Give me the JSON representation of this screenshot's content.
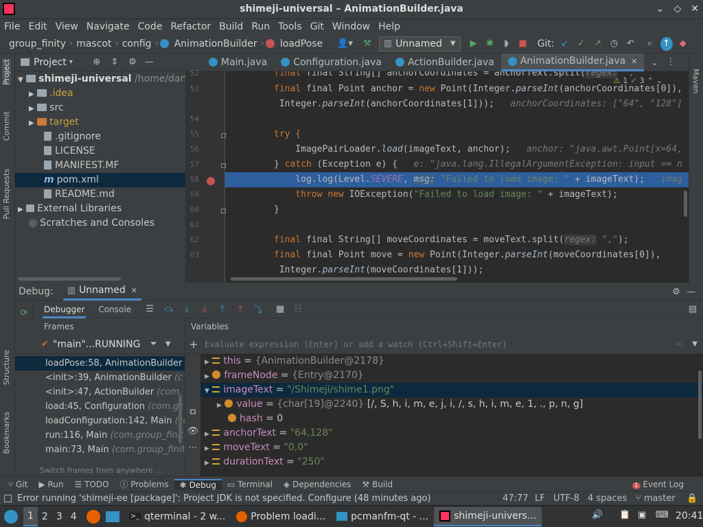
{
  "window": {
    "title": "shimeji-universal – AnimationBuilder.java"
  },
  "menu": [
    "File",
    "Edit",
    "View",
    "Navigate",
    "Code",
    "Refactor",
    "Build",
    "Run",
    "Tools",
    "Git",
    "Window",
    "Help"
  ],
  "breadcrumb": [
    "group_finity",
    "mascot",
    "config",
    "AnimationBuilder",
    "loadPose"
  ],
  "toolbar": {
    "run_config": "Unnamed",
    "git_label": "Git:"
  },
  "project": {
    "title": "Project",
    "root": "shimeji-universal",
    "root_path": "/home/dartz",
    "items": [
      ".idea",
      "src",
      "target",
      ".gitignore",
      "LICENSE",
      "MANIFEST.MF",
      "pom.xml",
      "README.md",
      "External Libraries",
      "Scratches and Consoles"
    ]
  },
  "side_left": [
    "Project",
    "Commit",
    "Pull Requests",
    "Structure",
    "Bookmarks"
  ],
  "side_right": [
    "Maven"
  ],
  "tabs": [
    "Main.java",
    "Configuration.java",
    "ActionBuilder.java",
    "AnimationBuilder.java"
  ],
  "inspections": {
    "warnings": "1",
    "ok": "3"
  },
  "code": {
    "line_numbers": [
      "52",
      "53",
      "",
      "54",
      "55",
      "56",
      "57",
      "58",
      "59",
      "60",
      "61",
      "62",
      "63",
      ""
    ],
    "l52": "final String[] anchorCoordinates = anchorText.split(",
    "l52_hint": "regex:",
    "l52_rest": "\",\"",
    "l53_a": "final Point anchor = ",
    "l53_b": "new",
    "l53_c": " Point(Integer.",
    "l53_d": "parseInt",
    "l53_e": "(anchorCoordinates[0]),",
    "l53c_a": " Integer.",
    "l53c_b": "parseInt",
    "l53c_c": "(anchorCoordinates[1]));",
    "l53c_hint": "anchorCoordinates: [\"64\", \"128\"]",
    "l55": "try {",
    "l56_a": "    ImagePairLoader.",
    "l56_b": "load",
    "l56_c": "(imageText, anchor);",
    "l56_hint": "anchor: \"java.awt.Point[x=64,",
    "l57_a": "} ",
    "l57_b": "catch",
    "l57_c": " (Exception e) {",
    "l57_hint": "e: \"java.lang.IllegalArgumentException: input == n",
    "l58_a": "    log.log(Level.",
    "l58_b": "SEVERE",
    "l58_c": ", ",
    "l58_hint": "msg:",
    "l58_d": "\"Failed to load image: \"",
    "l58_e": " + imageText);",
    "l58_hint2": "imag",
    "l59_a": "    throw new ",
    "l59_b": "IOException(",
    "l59_c": "\"Failed to load image: \"",
    "l59_d": " + imageText);",
    "l60": "}",
    "l62_a": "final String[] moveCoordinates = moveText.split(",
    "l62_hint": "regex:",
    "l62_b": "\",\"",
    "l62_c": ");",
    "l63_a": "final Point move = ",
    "l63_b": "new",
    "l63_c": " Point(Integer.",
    "l63_d": "parseInt",
    "l63_e": "(moveCoordinates[0]),",
    "l63c_a": " Integer.",
    "l63c_b": "parseInt",
    "l63c_c": "(moveCoordinates[1]));"
  },
  "debug": {
    "label": "Debug:",
    "session": "Unnamed",
    "tab_debugger": "Debugger",
    "tab_console": "Console",
    "frames_title": "Frames",
    "variables_title": "Variables",
    "thread": "\"main\"...RUNNING",
    "eval_placeholder": "Evaluate expression (Enter) or add a watch (Ctrl+Shift+Enter)",
    "switch_hint": "Switch frames from anywhere ..."
  },
  "frames": [
    {
      "m": "loadPose:58, AnimationBuilder",
      "p": ""
    },
    {
      "m": "<init>:39, AnimationBuilder",
      "p": "(c"
    },
    {
      "m": "<init>:47, ActionBuilder",
      "p": "(com."
    },
    {
      "m": "load:45, Configuration",
      "p": "(com.gr"
    },
    {
      "m": "loadConfiguration:142, Main",
      "p": "(co"
    },
    {
      "m": "run:116, Main",
      "p": "(com.group_finit"
    },
    {
      "m": "main:73, Main",
      "p": "(com.group_finit"
    }
  ],
  "variables": [
    {
      "n": "this",
      "v": "{AnimationBuilder@2178}",
      "k": "obj"
    },
    {
      "n": "frameNode",
      "v": "{Entry@2170}",
      "k": "obj"
    },
    {
      "n": "imageText",
      "v": "\"/Shimeji/shime1.png\"",
      "k": "str"
    },
    {
      "n": "value",
      "v": "{char[19]@2240}",
      "x": "[/, S, h, i, m, e, j, i, /, s, h, i, m, e, 1, ., p, n, g]",
      "k": "obj"
    },
    {
      "n": "hash",
      "v": "0",
      "k": "num"
    },
    {
      "n": "anchorText",
      "v": "\"64,128\"",
      "k": "str"
    },
    {
      "n": "moveText",
      "v": "\"0,0\"",
      "k": "str"
    },
    {
      "n": "durationText",
      "v": "\"250\"",
      "k": "str"
    }
  ],
  "bottom_tabs": [
    "Git",
    "Run",
    "TODO",
    "Problems",
    "Debug",
    "Terminal",
    "Dependencies",
    "Build"
  ],
  "event_log": "Event Log",
  "status": {
    "message": "Error running 'shimeji-ee [package]': Project JDK is not specified. Configure (48 minutes ago)",
    "position": "47:77",
    "line_sep": "LF",
    "encoding": "UTF-8",
    "indent": "4 spaces",
    "branch": "master"
  },
  "taskbar": {
    "workspaces": [
      "1",
      "2",
      "3",
      "4"
    ],
    "tasks": [
      "qterminal - 2 w...",
      "Problem loadi...",
      "pcmanfm-qt - ...",
      "shimeji-univers..."
    ],
    "clock": "20:41"
  }
}
